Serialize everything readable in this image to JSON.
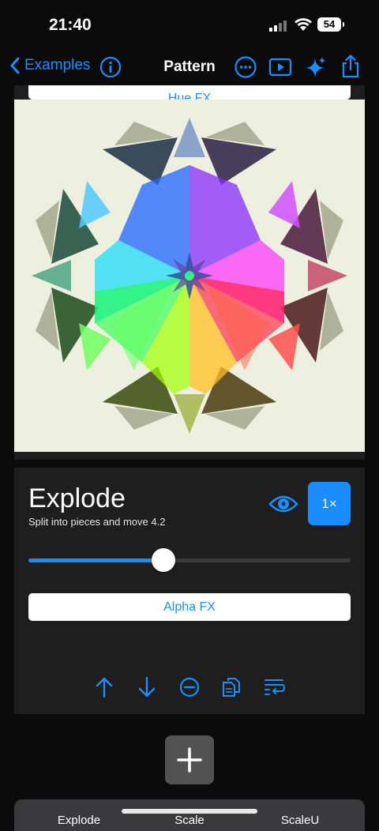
{
  "status": {
    "time": "21:40",
    "battery": "54"
  },
  "nav": {
    "back_label": "Examples",
    "title": "Pattern"
  },
  "top_effect": {
    "label": "Hue FX"
  },
  "effect": {
    "title": "Explode",
    "subtitle": "Split into pieces and move 4.2",
    "speed_label": "1×",
    "slider_value": 0.42,
    "secondary_button": "Alpha FX"
  },
  "bottom_tabs": [
    "Explode",
    "Scale",
    "ScaleU"
  ],
  "colors": {
    "accent": "#1a8cff",
    "canvas_bg": "#edf0df"
  },
  "icons": [
    "chevron-left-icon",
    "info-icon",
    "ellipsis-icon",
    "play-icon",
    "sparkles-icon",
    "share-icon",
    "eye-icon",
    "arrow-up-icon",
    "arrow-down-icon",
    "minus-circle-icon",
    "duplicate-icon",
    "text-wrap-icon",
    "plus-icon"
  ]
}
